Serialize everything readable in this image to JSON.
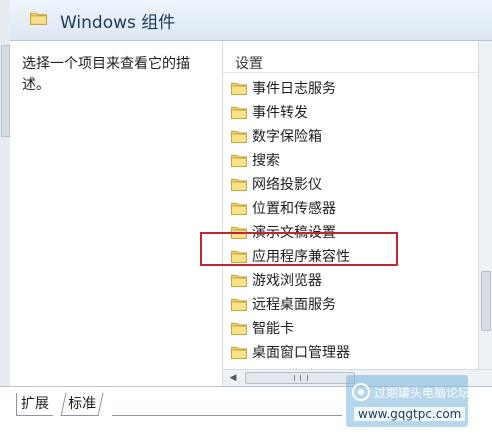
{
  "header": {
    "title": "Windows 组件",
    "icon": "folder-icon"
  },
  "description": {
    "text": "选择一个项目来查看它的描述。"
  },
  "list": {
    "column_header": "设置",
    "items": [
      {
        "label": "事件日志服务",
        "icon": "folder-icon"
      },
      {
        "label": "事件转发",
        "icon": "folder-icon"
      },
      {
        "label": "数字保险箱",
        "icon": "folder-icon"
      },
      {
        "label": "搜索",
        "icon": "folder-icon"
      },
      {
        "label": "网络投影仪",
        "icon": "folder-icon"
      },
      {
        "label": "位置和传感器",
        "icon": "folder-icon"
      },
      {
        "label": "演示文稿设置",
        "icon": "folder-icon"
      },
      {
        "label": "应用程序兼容性",
        "icon": "folder-icon",
        "highlighted": true
      },
      {
        "label": "游戏浏览器",
        "icon": "folder-icon"
      },
      {
        "label": "远程桌面服务",
        "icon": "folder-icon"
      },
      {
        "label": "智能卡",
        "icon": "folder-icon"
      },
      {
        "label": "桌面窗口管理器",
        "icon": "folder-icon"
      }
    ]
  },
  "tabs": [
    {
      "label": "扩展",
      "active": true
    },
    {
      "label": "标准",
      "active": false
    }
  ],
  "watermark": {
    "title": "过期罐头电脑论坛",
    "url": "www.gqgtpc.com"
  },
  "colors": {
    "highlight_border": "#c0262d",
    "header_text": "#1e395b",
    "folder": "#f2c94c"
  }
}
